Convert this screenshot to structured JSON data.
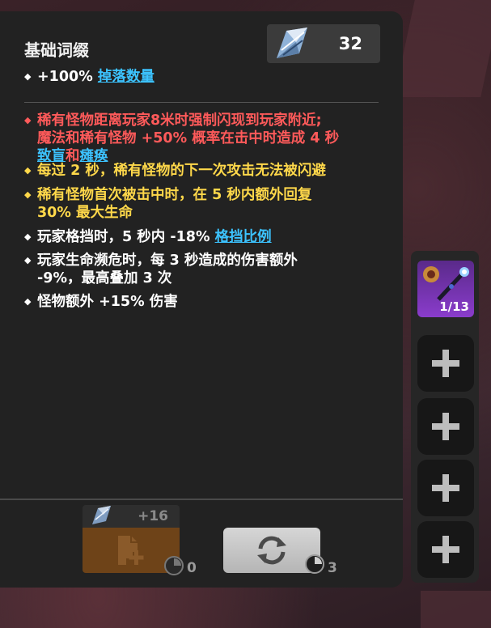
{
  "panel": {
    "title": "基础词缀",
    "crystal": {
      "icon": "crystal-icon",
      "count": "32"
    },
    "base_affix": {
      "prefix": "+100% ",
      "link": "掉落数量"
    },
    "affixes": {
      "a1_l1": "稀有怪物距离玩家8米时强制闪现到玩家附近;",
      "a1_l2": "魔法和稀有怪物 +50% 概率在击中时造成 4 秒",
      "a1_link1": "致盲",
      "a1_and": "和",
      "a1_link2": "瘫痪",
      "a2": "每过 2 秒，稀有怪物的下一次攻击无法被闪避",
      "a3_l1": "稀有怪物首次被击中时，在 5 秒内额外回复",
      "a3_l2": "30% 最大生命",
      "a4_prefix": "玩家格挡时，5 秒内 -18% ",
      "a4_link": "格挡比例",
      "a5_l1": "玩家生命濒危时，每 3 秒造成的伤害额外",
      "a5_l2": "-9%，最高叠加 3 次",
      "a6": "怪物额外 +15% 伤害"
    },
    "colors": {
      "red": "#ff5a5a",
      "yellow": "#ffd84a",
      "link": "#3cc3ff",
      "white": "#ffffff"
    }
  },
  "actions": {
    "add_affix": {
      "cost": "+16",
      "count": "0",
      "icon": "add-document-icon"
    },
    "reroll": {
      "count": "3",
      "icon": "refresh-icon"
    }
  },
  "sidebar": {
    "equipped": {
      "count": "1/13",
      "icon": "staff-icon"
    },
    "empty_slots": 4
  }
}
